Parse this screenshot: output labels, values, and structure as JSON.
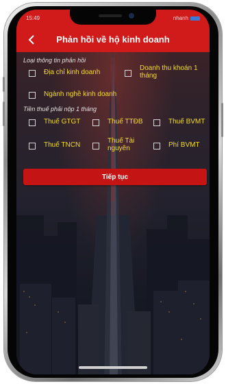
{
  "status": {
    "time": "15:49",
    "right": "nhanh"
  },
  "header": {
    "title": "Phản hồi về hộ kinh doanh"
  },
  "section1": {
    "label": "Loại thông tin phản hồi",
    "items": [
      {
        "label": "Địa chỉ kinh doanh"
      },
      {
        "label": "Doanh thu khoán 1 tháng"
      },
      {
        "label": "Ngành nghề kinh doanh"
      }
    ]
  },
  "section2": {
    "label": "Tiền thuế phải nộp 1 tháng",
    "items": [
      {
        "label": "Thuế GTGT"
      },
      {
        "label": "Thuế TTĐB"
      },
      {
        "label": "Thuế BVMT"
      },
      {
        "label": "Thuế TNCN"
      },
      {
        "label": "Thuế Tài nguyên"
      },
      {
        "label": "Phí BVMT"
      }
    ]
  },
  "button": {
    "label": "Tiếp tục"
  },
  "colors": {
    "header": "#d11a1a",
    "label": "#f5de2a",
    "button": "#c41414"
  }
}
